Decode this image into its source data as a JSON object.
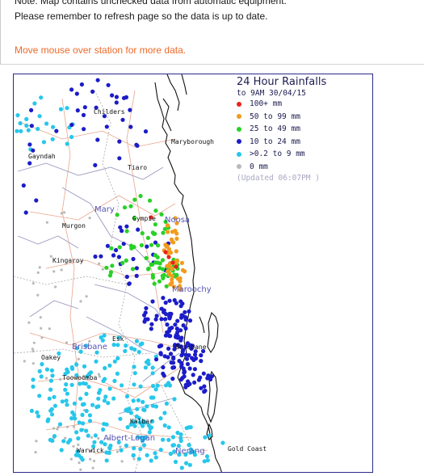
{
  "notes": {
    "line1": "Note: Map contains unchecked data from automatic equipment.",
    "line2": "Please remember to refresh page so the data is up to date.",
    "hover_hint": "Move mouse over station for more data."
  },
  "legend": {
    "title": "24 Hour Rainfalls",
    "subtitle": "to 9AM 30/04/15",
    "updated": "(Updated 06:07PM  )",
    "categories": [
      {
        "label": "100+ mm",
        "color": "#e8231c"
      },
      {
        "label": "50  to 99 mm",
        "color": "#f29b1d"
      },
      {
        "label": "25  to 49 mm",
        "color": "#27d226"
      },
      {
        "label": "10  to 24 mm",
        "color": "#1c1cc8"
      },
      {
        "label": ">0.2 to 9 mm",
        "color": "#27c7ea"
      },
      {
        "label": "0 mm",
        "color": "#b9b9b9"
      }
    ]
  },
  "places": {
    "childers": "Childers",
    "gayndah": "Gayndah",
    "maryborough": "Maryborough",
    "tiaro": "Tiaro",
    "gympie": "Gympie",
    "murgon": "Murgon",
    "kingaroy": "Kingaroy",
    "esk": "Esk",
    "oakey": "Oakey",
    "toowoomba": "Toowoomba",
    "brisbane_city": "Brisbane",
    "kalbar": "Kalbar",
    "warwick": "Warwick",
    "gold_coast": "Gold Coast"
  },
  "regions": {
    "mary": "Mary",
    "noosa": "Noosa",
    "maroochy": "Maroochy",
    "brisbane": "Brisbane",
    "albert_logan": "Albert-Logan",
    "nerang": "Nerang"
  },
  "colors": {
    "coast": "#111111",
    "river": "#8a8ab0",
    "road": "#e07a55",
    "boundary": "#9a9a9a"
  }
}
